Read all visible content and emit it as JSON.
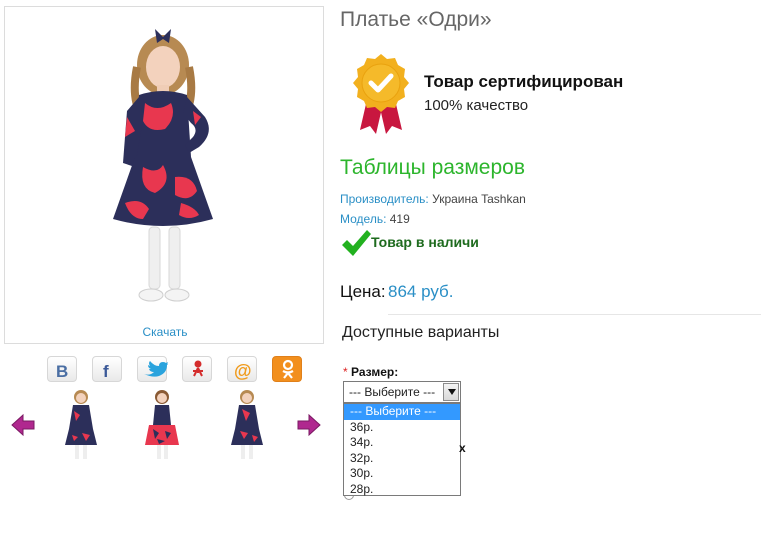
{
  "product": {
    "title": "Платье «Одри»",
    "download_label": "Скачать"
  },
  "certificate": {
    "title": "Товар сертифицирован",
    "subtitle": "100% качество"
  },
  "size_table_link": "Таблицы размеров",
  "meta": {
    "manufacturer_label": "Производитель:",
    "manufacturer_value": "Украина Tashkan",
    "model_label": "Модель:",
    "model_value": "419"
  },
  "stock_status": "Товар в наличи",
  "price": {
    "label": "Цена:",
    "value": "864 руб."
  },
  "variants": {
    "heading": "Доступные варианты",
    "required_mark": "*",
    "size_label": "Размер:",
    "select_value": "--- Выберите ---",
    "options": [
      "--- Выберите ---",
      "36р.",
      "34р.",
      "32р.",
      "30р.",
      "28р."
    ],
    "partial_text": "х"
  },
  "share_icons": [
    "vk-icon",
    "facebook-icon",
    "twitter-icon",
    "odnoklassniki-alt-icon",
    "mail-ru-icon",
    "odnoklassniki-icon"
  ],
  "colors": {
    "link_blue": "#2a8fc6",
    "green": "#2cb52c",
    "dress_red": "#e8374f",
    "dress_navy": "#2c2f5a",
    "arrow_purple": "#b0288f",
    "badge_gold": "#f2b01e",
    "ribbon_red": "#c8173f",
    "selected_blue": "#3399ff"
  }
}
